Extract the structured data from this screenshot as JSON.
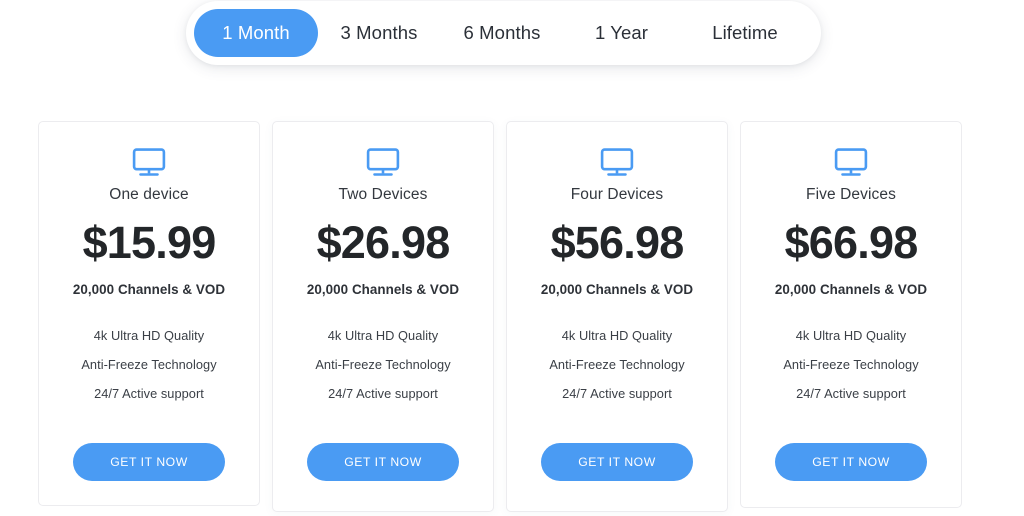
{
  "billing_tabs": {
    "selected": "1 Month",
    "items": [
      {
        "label": "1 Month",
        "active": true
      },
      {
        "label": "3 Months",
        "active": false
      },
      {
        "label": "6 Months",
        "active": false
      },
      {
        "label": "1 Year",
        "active": false
      },
      {
        "label": "Lifetime",
        "active": false
      }
    ]
  },
  "colors": {
    "accent": "#4a9bf3",
    "page_background": "#ffffff",
    "card_border": "#ececef",
    "price_text": "#232629",
    "body_text": "#3a3f46"
  },
  "plans": [
    {
      "icon": "monitor-icon",
      "device_name": "One device",
      "price": "$15.99",
      "channels": "20,000 Channels & VOD",
      "features": [
        "4k Ultra HD Quality",
        "Anti-Freeze Technology",
        "24/7 Active support"
      ],
      "cta_label": "GET IT NOW"
    },
    {
      "icon": "monitor-icon",
      "device_name": "Two Devices",
      "price": "$26.98",
      "channels": "20,000 Channels & VOD",
      "features": [
        "4k Ultra HD Quality",
        "Anti-Freeze Technology",
        "24/7 Active support"
      ],
      "cta_label": "GET IT NOW"
    },
    {
      "icon": "monitor-icon",
      "device_name": "Four Devices",
      "price": "$56.98",
      "channels": "20,000 Channels & VOD",
      "features": [
        "4k Ultra HD Quality",
        "Anti-Freeze Technology",
        "24/7 Active support"
      ],
      "cta_label": "GET IT NOW"
    },
    {
      "icon": "monitor-icon",
      "device_name": "Five Devices",
      "price": "$66.98",
      "channels": "20,000 Channels & VOD",
      "features": [
        "4k Ultra HD Quality",
        "Anti-Freeze Technology",
        "24/7 Active support"
      ],
      "cta_label": "GET IT NOW"
    }
  ]
}
